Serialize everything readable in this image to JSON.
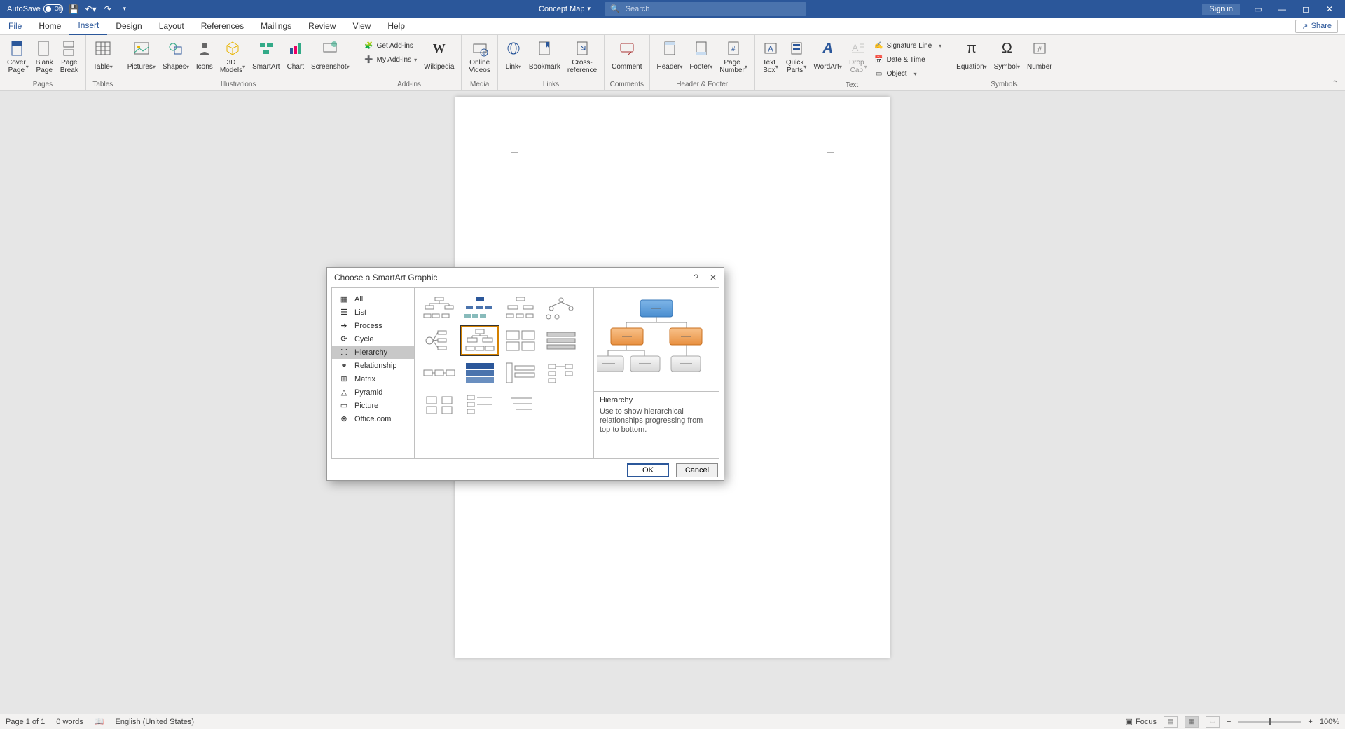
{
  "title_bar": {
    "autosave_label": "AutoSave",
    "autosave_state": "Off",
    "doc_title": "Concept Map",
    "search_placeholder": "Search",
    "signin": "Sign in"
  },
  "tabs": {
    "file": "File",
    "home": "Home",
    "insert": "Insert",
    "design": "Design",
    "layout": "Layout",
    "references": "References",
    "mailings": "Mailings",
    "review": "Review",
    "view": "View",
    "help": "Help",
    "share": "Share"
  },
  "ribbon": {
    "groups": {
      "pages": "Pages",
      "tables": "Tables",
      "illustrations": "Illustrations",
      "addins": "Add-ins",
      "media": "Media",
      "links": "Links",
      "comments": "Comments",
      "headerfooter": "Header & Footer",
      "text": "Text",
      "symbols": "Symbols"
    },
    "btn": {
      "cover_page": "Cover\nPage",
      "blank_page": "Blank\nPage",
      "page_break": "Page\nBreak",
      "table": "Table",
      "pictures": "Pictures",
      "shapes": "Shapes",
      "icons": "Icons",
      "models": "3D\nModels",
      "smartart": "SmartArt",
      "chart": "Chart",
      "screenshot": "Screenshot",
      "get_addins": "Get Add-ins",
      "my_addins": "My Add-ins",
      "wikipedia": "Wikipedia",
      "online_videos": "Online\nVideos",
      "link": "Link",
      "bookmark": "Bookmark",
      "crossref": "Cross-\nreference",
      "comment": "Comment",
      "header": "Header",
      "footer": "Footer",
      "page_number": "Page\nNumber",
      "text_box": "Text\nBox",
      "quick_parts": "Quick\nParts",
      "wordart": "WordArt",
      "drop_cap": "Drop\nCap",
      "signature": "Signature Line",
      "datetime": "Date & Time",
      "object": "Object",
      "equation": "Equation",
      "symbol": "Symbol",
      "number": "Number"
    }
  },
  "dialog": {
    "title": "Choose a SmartArt Graphic",
    "help": "?",
    "categories": {
      "all": "All",
      "list": "List",
      "process": "Process",
      "cycle": "Cycle",
      "hierarchy": "Hierarchy",
      "relationship": "Relationship",
      "matrix": "Matrix",
      "pyramid": "Pyramid",
      "picture": "Picture",
      "office": "Office.com"
    },
    "preview": {
      "title": "Hierarchy",
      "desc": "Use to show hierarchical relationships progressing from top to bottom."
    },
    "ok": "OK",
    "cancel": "Cancel"
  },
  "status": {
    "page": "Page 1 of 1",
    "words": "0 words",
    "language": "English (United States)",
    "focus": "Focus",
    "zoom": "100%"
  }
}
